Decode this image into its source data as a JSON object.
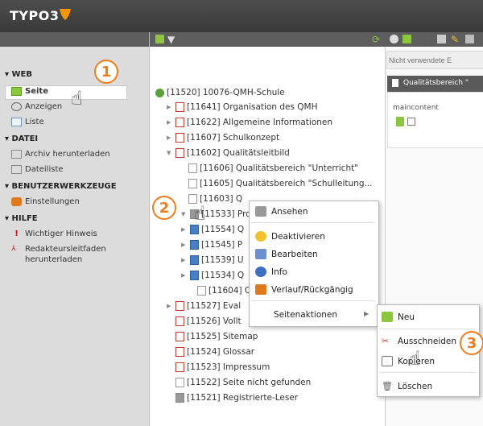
{
  "app": {
    "logo_text": "TYPO3"
  },
  "menu": {
    "web": {
      "label": "▾ WEB",
      "items": [
        "Seite",
        "Anzeigen",
        "Liste"
      ]
    },
    "datei": {
      "label": "▾ DATEI",
      "items": [
        "Archiv herunterladen",
        "Dateiliste"
      ]
    },
    "benutzer": {
      "label": "▾ BENUTZERWERKZEUGE",
      "items": [
        "Einstellungen"
      ]
    },
    "hilfe": {
      "label": "▾ HILFE",
      "items": [
        "Wichtiger Hinweis",
        "Redakteursleitfaden",
        "herunterladen"
      ]
    }
  },
  "right": {
    "filter_placeholder": "Nicht verwendete E",
    "panel_title": "Qualitätsbereich \"",
    "maincontent": "maincontent"
  },
  "tree": [
    "[11520] 10076-QMH-Schule",
    "[11641] Organisation des QMH",
    "[11622] Allgemeine Informationen",
    "[11607] Schulkonzept",
    "[11602] Qualitätsleitbild",
    "[11606] Qualitätsbereich \"Unterricht\"",
    "[11605] Qualitätsbereich \"Schulleitung...",
    "[11603] Q",
    "[11533] Proz",
    "[11554] Q",
    "[11545] P",
    "[11539] U",
    "[11534] Q",
    "[11604] Q",
    "[11527] Eval",
    "[11526] Vollt",
    "[11525] Sitemap",
    "[11524] Glossar",
    "[11523] Impressum",
    "[11522] Seite nicht gefunden",
    "[11521] Registrierte-Leser"
  ],
  "context_menu": {
    "items": [
      "Ansehen",
      "Deaktivieren",
      "Bearbeiten",
      "Info",
      "Verlauf/Rückgängig",
      "Seitenaktionen"
    ]
  },
  "submenu": {
    "items": [
      "Neu",
      "Ausschneiden",
      "Kopieren",
      "Löschen"
    ]
  },
  "callouts": [
    "1",
    "2",
    "3"
  ],
  "colors": {
    "accent": "#f07c1b",
    "topbar": "#3f3f3f",
    "sidebar": "#dcdcdc"
  }
}
